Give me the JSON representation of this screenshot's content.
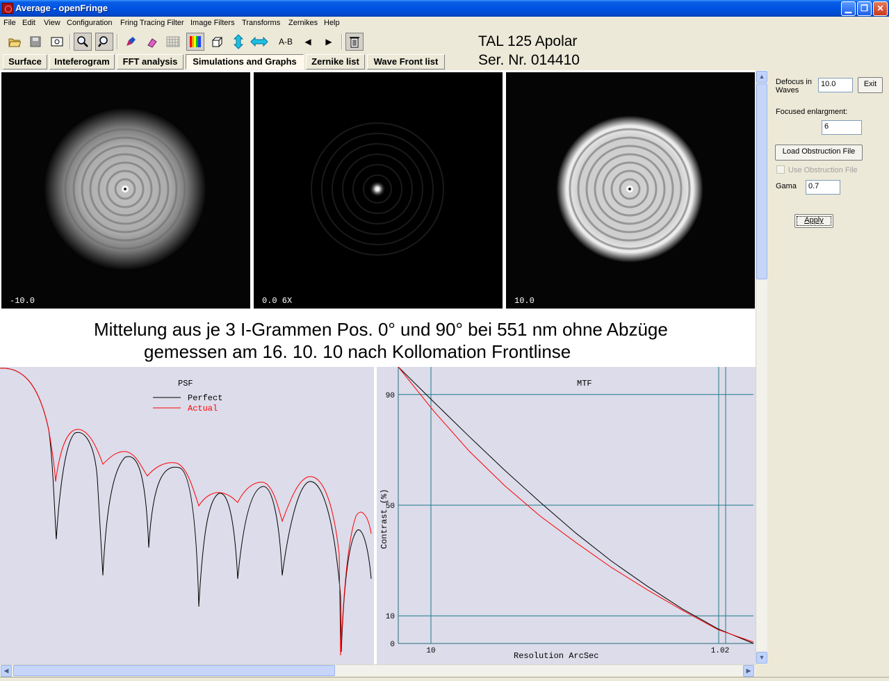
{
  "window": {
    "title": "Average - openFringe"
  },
  "menu": [
    "File",
    "Edit",
    "View",
    "Configuration",
    "Fring Tracing Filter",
    "Image Filters",
    "Transforms",
    "Zernikes",
    "Help"
  ],
  "toolbar": {
    "ab_label": "A-B"
  },
  "scope": {
    "title": "TAL 125 Apolar",
    "serial": "Ser. Nr. 014410"
  },
  "tabs": [
    "Surface",
    "Inteferogram",
    "FFT analysis",
    "Simulations and Graphs",
    "Zernike list",
    "Wave Front list"
  ],
  "active_tab": "Simulations and Graphs",
  "star_images": [
    {
      "label": "-10.0"
    },
    {
      "label": "0.0 6X"
    },
    {
      "label": "10.0"
    }
  ],
  "headline": {
    "line1": "Mittelung aus je 3 I-Grammen Pos. 0° und 90° bei 551 nm  ohne Abzüge",
    "line2": "gemessen am 16. 10. 10 nach Kollomation Frontlinse"
  },
  "panel": {
    "defocus_label": "Defocus in Waves",
    "defocus_value": "10.0",
    "exit_label": "Exit",
    "focused_label": "Focused enlargment:",
    "focused_value": "6",
    "load_obstruction_label": "Load Obstruction File",
    "use_obstruction_label": "Use Obstruction File",
    "use_obstruction_checked": false,
    "gama_label": "Gama",
    "gama_value": "0.7",
    "apply_label": "Apply"
  },
  "chart_data": [
    {
      "type": "line",
      "title": "PSF",
      "series": [
        {
          "name": "Perfect",
          "color": "#000000"
        },
        {
          "name": "Actual",
          "color": "#ff0000"
        }
      ]
    },
    {
      "type": "line",
      "title": "MTF",
      "xlabel": "Resolution  ArcSec",
      "ylabel": "Contrast (%)",
      "ylim": [
        0,
        100
      ],
      "y_ticks": [
        0,
        10,
        50,
        90
      ],
      "x_tick_labels": [
        "10",
        "1.02"
      ],
      "grid": true,
      "series": [
        {
          "name": "Perfect",
          "color": "#000000",
          "x": [
            0,
            0.1,
            0.2,
            0.3,
            0.4,
            0.5,
            0.6,
            0.7,
            0.8,
            0.9,
            1.0
          ],
          "y": [
            100,
            87.3,
            74.8,
            62.6,
            51.0,
            39.9,
            29.8,
            20.8,
            12.5,
            5.3,
            0
          ]
        },
        {
          "name": "Actual",
          "color": "#ff0000",
          "x": [
            0,
            0.1,
            0.2,
            0.3,
            0.4,
            0.5,
            0.6,
            0.7,
            0.8,
            0.9,
            1.0
          ],
          "y": [
            100,
            84.0,
            69.5,
            57.0,
            46.0,
            36.5,
            27.5,
            19.5,
            12.0,
            5.0,
            0.5
          ]
        }
      ]
    }
  ]
}
